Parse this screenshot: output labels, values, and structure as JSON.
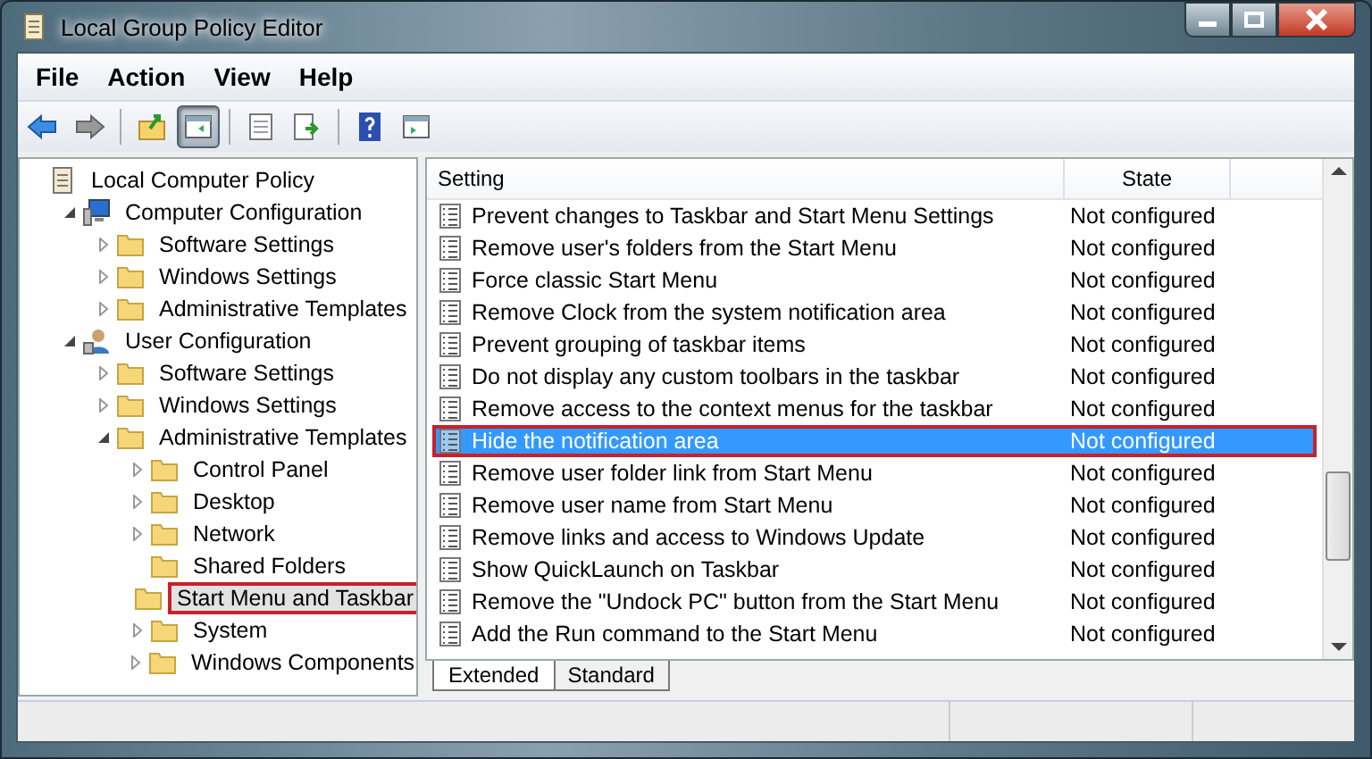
{
  "window": {
    "title": "Local Group Policy Editor"
  },
  "menu": [
    "File",
    "Action",
    "View",
    "Help"
  ],
  "toolbar": [
    {
      "kind": "back",
      "pressed": false
    },
    {
      "kind": "forward",
      "pressed": false
    },
    {
      "kind": "separator"
    },
    {
      "kind": "up",
      "pressed": false
    },
    {
      "kind": "tree",
      "pressed": true
    },
    {
      "kind": "separator"
    },
    {
      "kind": "properties",
      "pressed": false
    },
    {
      "kind": "export",
      "pressed": false
    },
    {
      "kind": "separator"
    },
    {
      "kind": "help",
      "pressed": false
    },
    {
      "kind": "pane",
      "pressed": false
    }
  ],
  "tree": [
    {
      "label": "Local Computer Policy",
      "selected": false,
      "marked": false,
      "children": [
        {
          "label": "Computer Configuration",
          "expanded": true,
          "selected": false,
          "marked": false,
          "children": [
            {
              "label": "Software Settings",
              "expanded": false,
              "selected": false,
              "marked": false
            },
            {
              "label": "Windows Settings",
              "expanded": false,
              "selected": false,
              "marked": false
            },
            {
              "label": "Administrative Templates",
              "expanded": false,
              "selected": false,
              "marked": false
            }
          ]
        },
        {
          "label": "User Configuration",
          "expanded": true,
          "selected": false,
          "marked": false,
          "children": [
            {
              "label": "Software Settings",
              "expanded": false,
              "selected": false,
              "marked": false
            },
            {
              "label": "Windows Settings",
              "expanded": false,
              "selected": false,
              "marked": false
            },
            {
              "label": "Administrative Templates",
              "expanded": true,
              "selected": false,
              "marked": false,
              "children": [
                {
                  "label": "Control Panel",
                  "expanded": false,
                  "selected": false,
                  "marked": false
                },
                {
                  "label": "Desktop",
                  "expanded": false,
                  "selected": false,
                  "marked": false
                },
                {
                  "label": "Network",
                  "expanded": false,
                  "selected": false,
                  "marked": false
                },
                {
                  "label": "Shared Folders",
                  "selected": false,
                  "marked": false
                },
                {
                  "label": "Start Menu and Taskbar",
                  "selected": true,
                  "marked": true
                },
                {
                  "label": "System",
                  "expanded": false,
                  "selected": false,
                  "marked": false
                },
                {
                  "label": "Windows Components",
                  "expanded": false,
                  "selected": false,
                  "marked": false
                }
              ]
            }
          ]
        }
      ]
    }
  ],
  "table": {
    "columns": [
      "Setting",
      "State"
    ],
    "rows": [
      {
        "setting": "Prevent changes to Taskbar and Start Menu Settings",
        "state": "Not configured",
        "selected": false,
        "marked": false
      },
      {
        "setting": "Remove user's folders from the Start Menu",
        "state": "Not configured",
        "selected": false,
        "marked": false
      },
      {
        "setting": "Force classic Start Menu",
        "state": "Not configured",
        "selected": false,
        "marked": false
      },
      {
        "setting": "Remove Clock from the system notification area",
        "state": "Not configured",
        "selected": false,
        "marked": false
      },
      {
        "setting": "Prevent grouping of taskbar items",
        "state": "Not configured",
        "selected": false,
        "marked": false
      },
      {
        "setting": "Do not display any custom toolbars in the taskbar",
        "state": "Not configured",
        "selected": false,
        "marked": false
      },
      {
        "setting": "Remove access to the context menus for the taskbar",
        "state": "Not configured",
        "selected": false,
        "marked": false
      },
      {
        "setting": "Hide the notification area",
        "state": "Not configured",
        "selected": true,
        "marked": true
      },
      {
        "setting": "Remove user folder link from Start Menu",
        "state": "Not configured",
        "selected": false,
        "marked": false
      },
      {
        "setting": "Remove user name from Start Menu",
        "state": "Not configured",
        "selected": false,
        "marked": false
      },
      {
        "setting": "Remove links and access to Windows Update",
        "state": "Not configured",
        "selected": false,
        "marked": false
      },
      {
        "setting": "Show QuickLaunch on Taskbar",
        "state": "Not configured",
        "selected": false,
        "marked": false
      },
      {
        "setting": "Remove the \"Undock PC\" button from the Start Menu",
        "state": "Not configured",
        "selected": false,
        "marked": false
      },
      {
        "setting": "Add the Run command to the Start Menu",
        "state": "Not configured",
        "selected": false,
        "marked": false
      }
    ]
  },
  "tabs": [
    {
      "label": "Extended",
      "selected": true
    },
    {
      "label": "Standard",
      "selected": false
    }
  ]
}
